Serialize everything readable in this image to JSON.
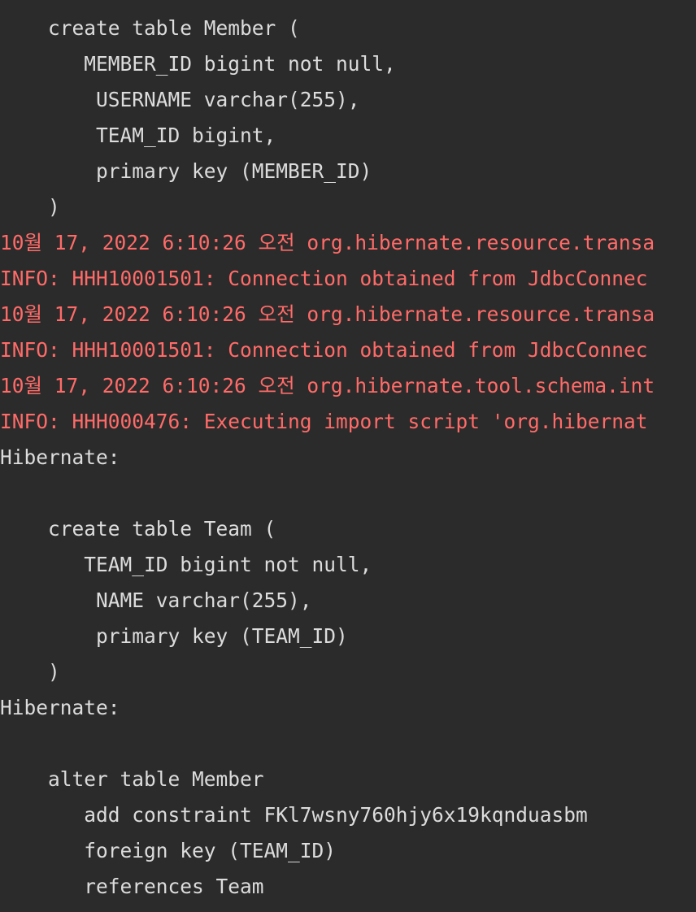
{
  "console": {
    "lines": [
      {
        "text": "    create table Member (",
        "kind": "output"
      },
      {
        "text": "       MEMBER_ID bigint not null,",
        "kind": "output"
      },
      {
        "text": "        USERNAME varchar(255),",
        "kind": "output"
      },
      {
        "text": "        TEAM_ID bigint,",
        "kind": "output"
      },
      {
        "text": "        primary key (MEMBER_ID)",
        "kind": "output"
      },
      {
        "text": "    )",
        "kind": "output"
      },
      {
        "text": "10월 17, 2022 6:10:26 오전 org.hibernate.resource.transa",
        "kind": "error"
      },
      {
        "text": "INFO: HHH10001501: Connection obtained from JdbcConnec",
        "kind": "error"
      },
      {
        "text": "10월 17, 2022 6:10:26 오전 org.hibernate.resource.transa",
        "kind": "error"
      },
      {
        "text": "INFO: HHH10001501: Connection obtained from JdbcConnec",
        "kind": "error"
      },
      {
        "text": "10월 17, 2022 6:10:26 오전 org.hibernate.tool.schema.int",
        "kind": "error"
      },
      {
        "text": "INFO: HHH000476: Executing import script 'org.hibernat",
        "kind": "error"
      },
      {
        "text": "Hibernate:",
        "kind": "output"
      },
      {
        "text": "",
        "kind": "output"
      },
      {
        "text": "    create table Team (",
        "kind": "output"
      },
      {
        "text": "       TEAM_ID bigint not null,",
        "kind": "output"
      },
      {
        "text": "        NAME varchar(255),",
        "kind": "output"
      },
      {
        "text": "        primary key (TEAM_ID)",
        "kind": "output"
      },
      {
        "text": "    )",
        "kind": "output"
      },
      {
        "text": "Hibernate:",
        "kind": "output"
      },
      {
        "text": "",
        "kind": "output"
      },
      {
        "text": "    alter table Member",
        "kind": "output"
      },
      {
        "text": "       add constraint FKl7wsny760hjy6x19kqnduasbm",
        "kind": "output"
      },
      {
        "text": "       foreign key (TEAM_ID)",
        "kind": "output"
      },
      {
        "text": "       references Team",
        "kind": "output"
      }
    ]
  },
  "colors": {
    "background": "#2b2b2b",
    "output_text": "#dcdcdc",
    "error_text": "#ff6b68"
  }
}
